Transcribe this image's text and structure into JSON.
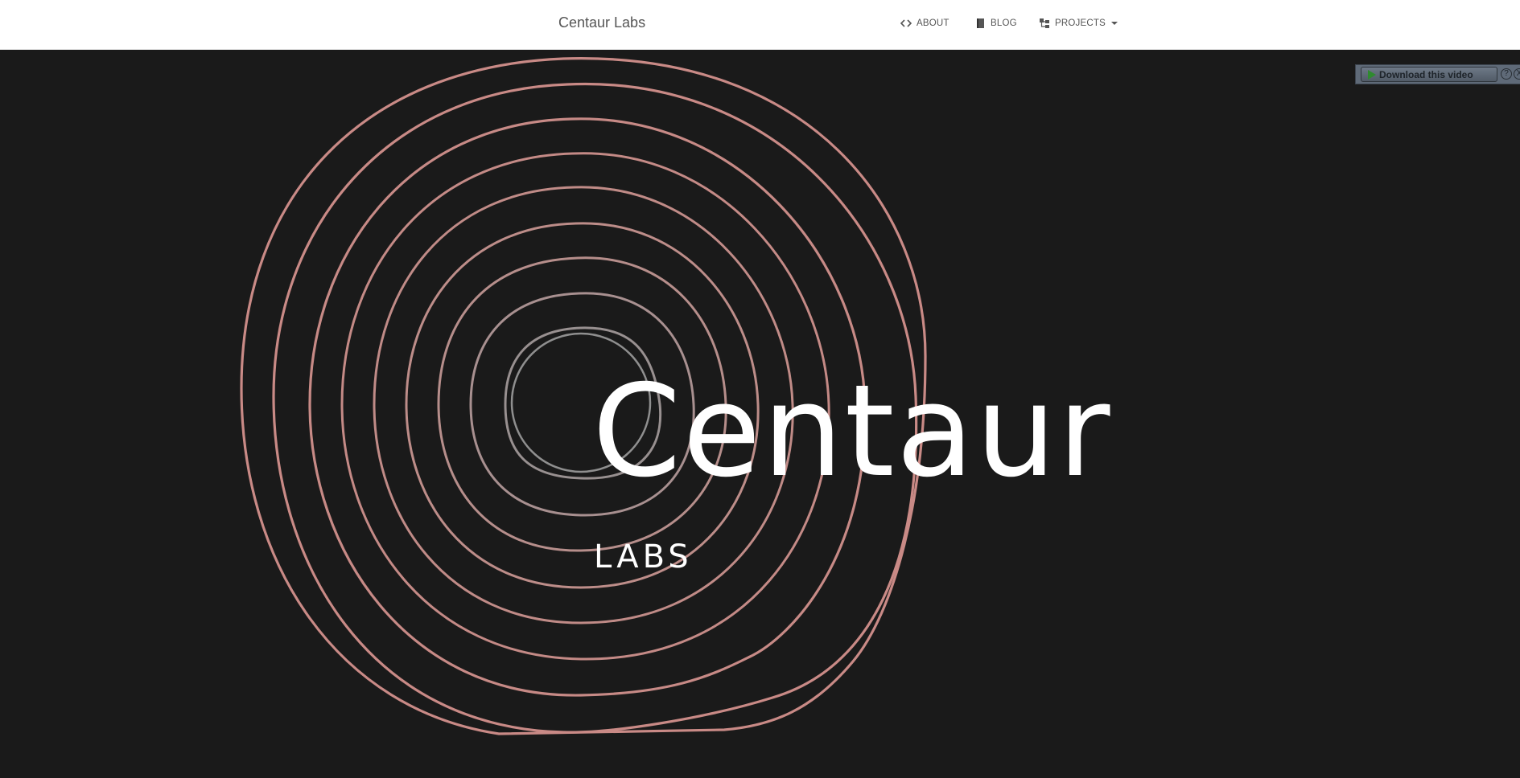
{
  "navbar": {
    "brand": "Centaur Labs",
    "items": [
      {
        "label": "ABOUT",
        "icon": "code-icon"
      },
      {
        "label": "BLOG",
        "icon": "book-icon"
      },
      {
        "label": "PROJECTS",
        "icon": "sitemap-icon",
        "dropdown": true
      }
    ]
  },
  "hero": {
    "logo_title": "Centaur",
    "logo_subtitle": "LABS",
    "ring_color": "#c98a86",
    "background": "#1a1a1a"
  },
  "download_bar": {
    "button_label": "Download this video",
    "help_label": "?",
    "close_label": "X"
  }
}
